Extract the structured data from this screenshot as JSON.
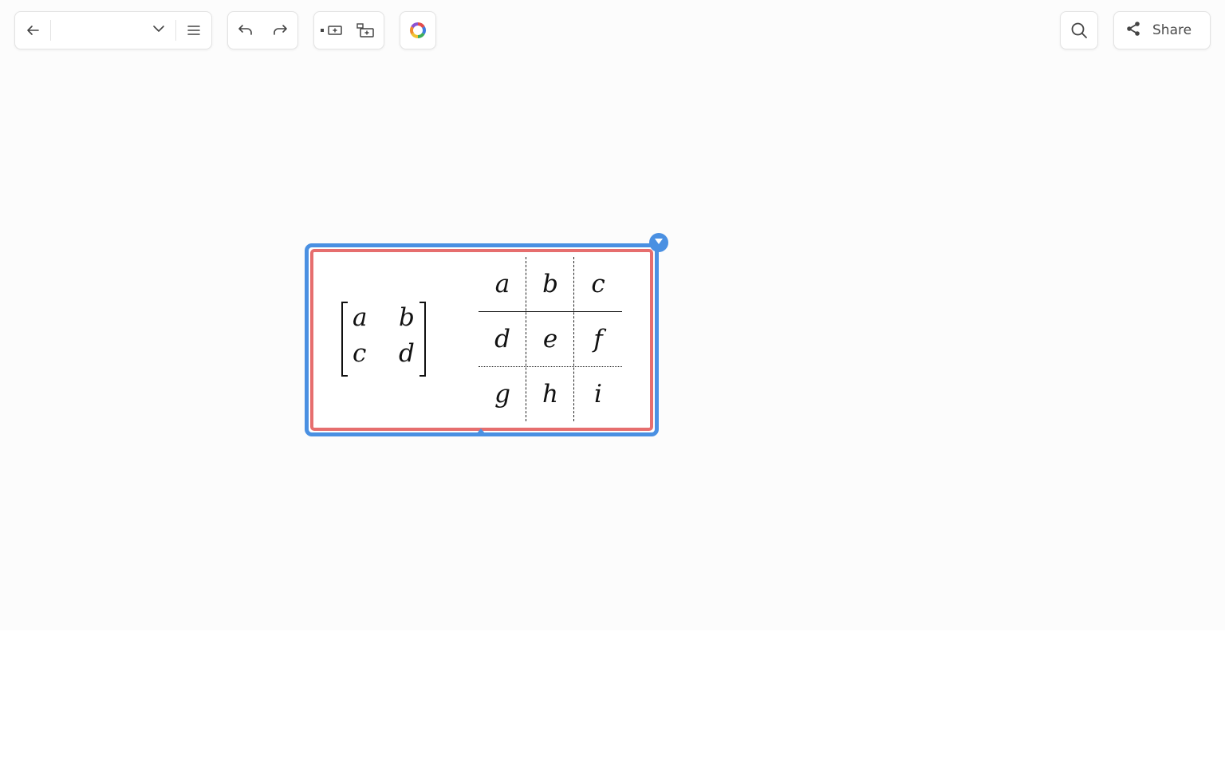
{
  "toolbar": {
    "back_icon": "arrow-left-icon",
    "document_title": "",
    "dropdown_icon": "chevron-down-icon",
    "menu_icon": "hamburger-menu-icon",
    "undo_icon": "undo-icon",
    "redo_icon": "redo-icon",
    "insert_inline_icon": "insert-inline-box-icon",
    "insert_block_icon": "insert-block-box-icon",
    "color_icon": "color-wheel-icon",
    "search_icon": "search-icon",
    "share_icon": "share-icon",
    "share_label": "Share"
  },
  "math_block": {
    "matrix": {
      "rows": [
        [
          "a",
          "b"
        ],
        [
          "c",
          "d"
        ]
      ]
    },
    "table": {
      "rows": [
        [
          "a",
          "b",
          "c"
        ],
        [
          "d",
          "e",
          "f"
        ],
        [
          "g",
          "h",
          "i"
        ]
      ]
    }
  },
  "colors": {
    "selection_border": "#4a90e2",
    "block_border": "#e66e6e",
    "canvas_bg": "#fcfcfc"
  }
}
